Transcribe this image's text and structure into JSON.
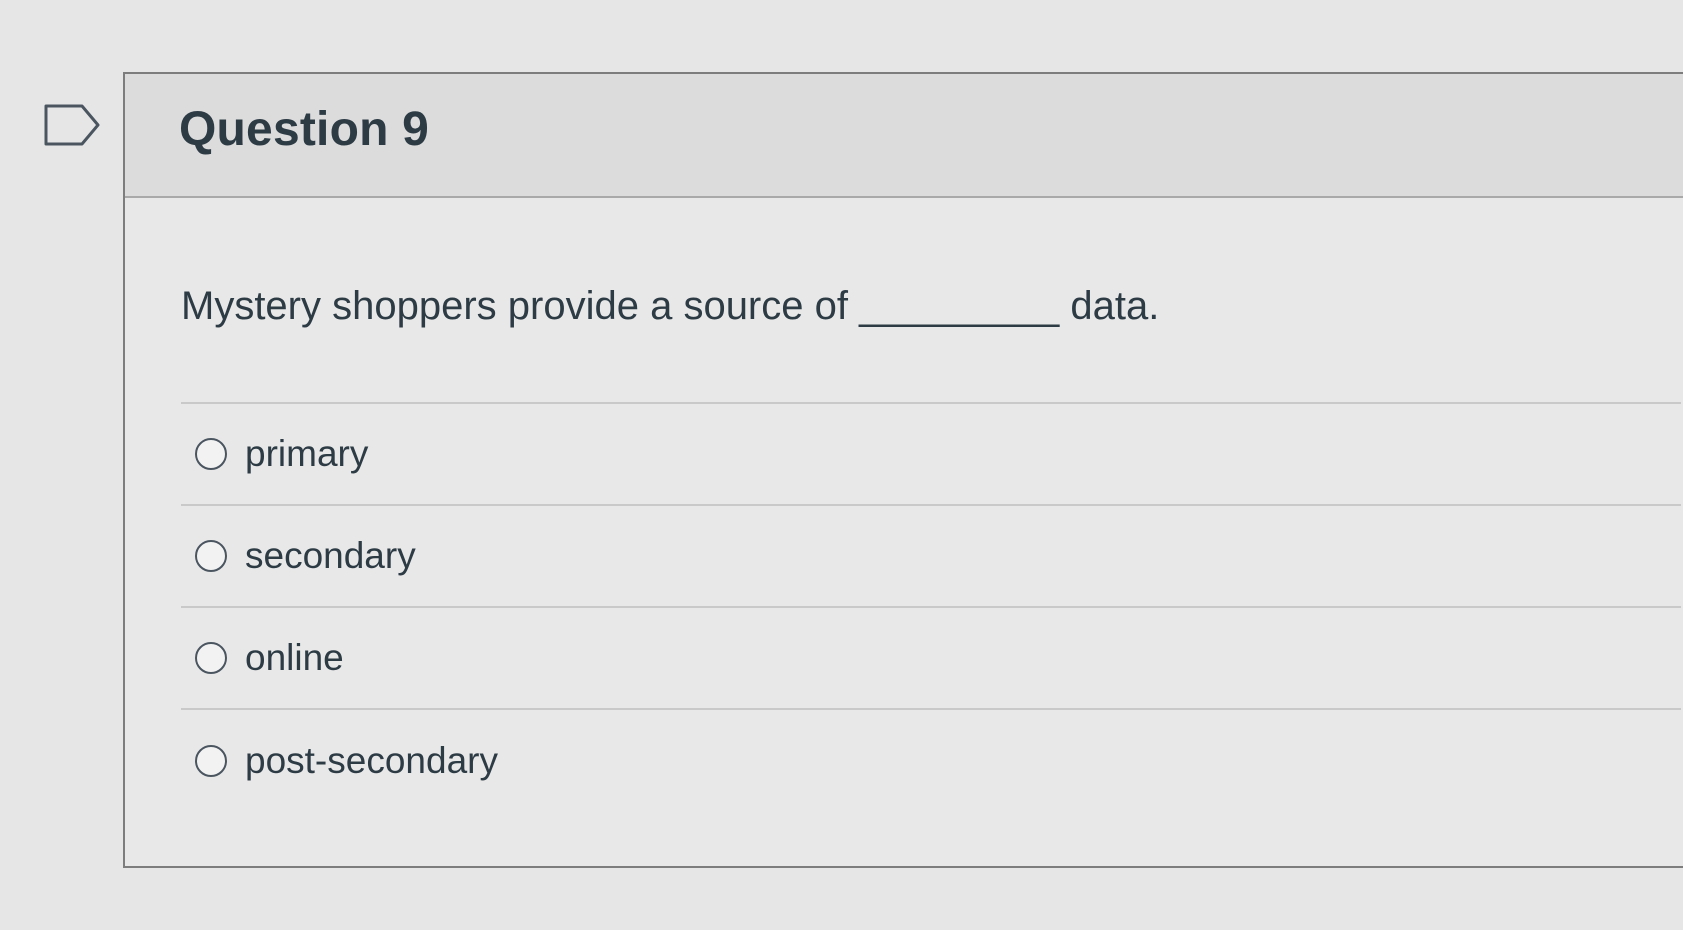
{
  "question": {
    "title": "Question 9",
    "prompt": "Mystery shoppers provide a source of _________ data.",
    "flag_icon": "flag-icon",
    "answers": [
      {
        "label": "primary",
        "selected": false
      },
      {
        "label": "secondary",
        "selected": false
      },
      {
        "label": "online",
        "selected": false
      },
      {
        "label": "post-secondary",
        "selected": false
      }
    ]
  },
  "colors": {
    "background": "#e6e6e6",
    "header_background": "#dcdcdc",
    "text": "#2d3b45",
    "border": "#7d7d7d"
  }
}
